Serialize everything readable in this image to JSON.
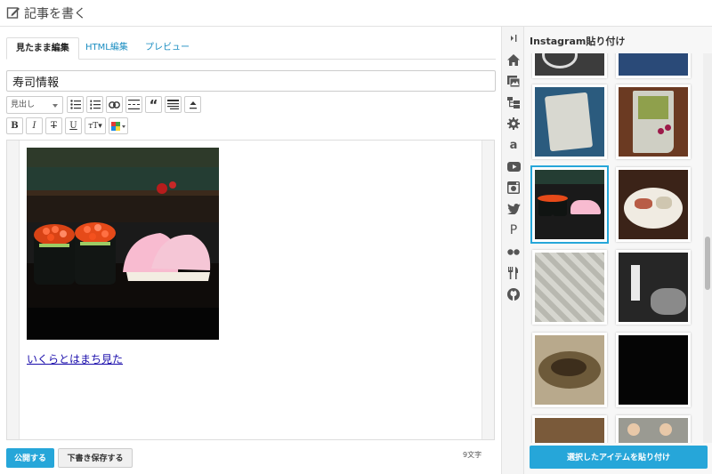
{
  "header": {
    "title": "記事を書く",
    "icon": "edit-icon"
  },
  "editor": {
    "tabs": [
      {
        "label": "見たまま編集",
        "active": true
      },
      {
        "label": "HTML編集",
        "active": false
      },
      {
        "label": "プレビュー",
        "active": false
      }
    ],
    "title_value": "寿司情報",
    "format_select": "見出し",
    "toolbar_row1": [
      "bullet-list-icon",
      "numbered-list-icon",
      "link-icon",
      "more-break-icon",
      "quote-icon",
      "table-of-contents-icon",
      "upload-icon"
    ],
    "toolbar_row2": [
      "bold-icon",
      "italic-icon",
      "strikethrough-icon",
      "underline-icon",
      "font-size-icon",
      "text-color-icon"
    ],
    "body": {
      "image": "sushi-photo",
      "link_text": "いくらとはまち見た"
    },
    "publish_label": "公開する",
    "draft_label": "下書き保存する",
    "char_count": "9文字"
  },
  "icon_strip": [
    "collapse-panel-icon",
    "home-icon",
    "photo-album-icon",
    "tree-icon",
    "gear-icon",
    "amazon-icon",
    "youtube-icon",
    "instagram-icon",
    "twitter-icon",
    "pixiv-icon",
    "flickr-icon",
    "restaurant-icon",
    "github-icon"
  ],
  "instagram_panel": {
    "title": "Instagram貼り付け",
    "paste_button": "選択したアイテムを貼り付け",
    "selected_index": 4
  },
  "colors": {
    "accent": "#26a6d9",
    "link": "#1a0dab",
    "tab_link": "#1a8dc1"
  }
}
